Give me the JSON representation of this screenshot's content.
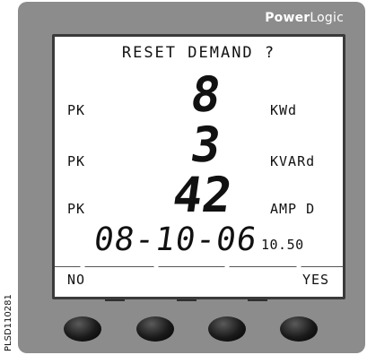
{
  "brand": {
    "bold": "Power",
    "light": "Logic"
  },
  "display": {
    "prompt": "RESET DEMAND ?",
    "rows": [
      {
        "label": "PK",
        "value": "8",
        "unit": "KWd"
      },
      {
        "label": "PK",
        "value": "3",
        "unit": "KVARd"
      },
      {
        "label": "PK",
        "value": "42",
        "unit": "AMP D"
      }
    ],
    "date": "08-10-06",
    "time": "10.50"
  },
  "softkeys": {
    "left": "NO",
    "right": "YES"
  },
  "side_code": "PLSD110281"
}
